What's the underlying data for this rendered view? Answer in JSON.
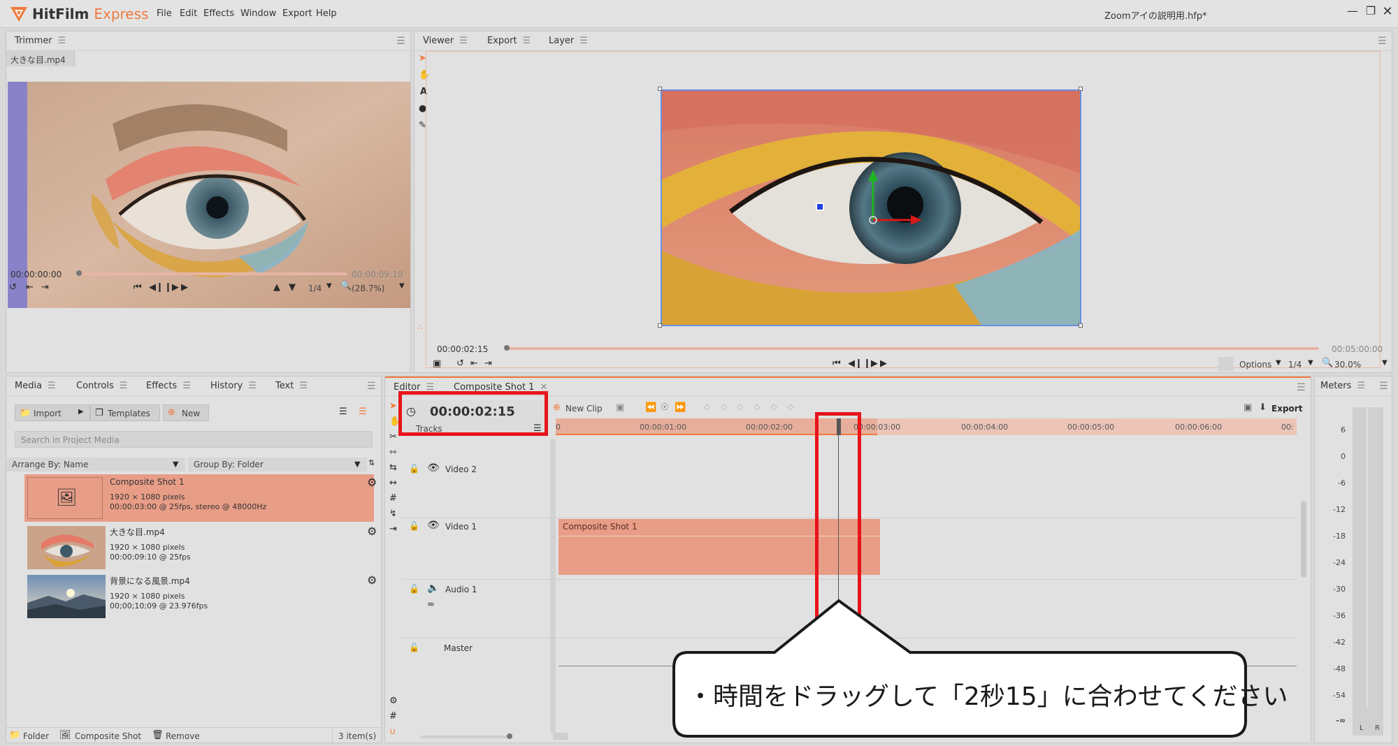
{
  "app": {
    "name_main": "HitFilm",
    "name_accent": "Express",
    "project_title": "Zoomアイの説明用.hfp*",
    "menu": [
      "File",
      "Edit",
      "Effects",
      "Window",
      "Export",
      "Help"
    ]
  },
  "trimmer": {
    "tab": "Trimmer",
    "file_tab": "大きな目.mp4",
    "time_current": "00:00:00:00",
    "time_total": "00:00:09:10",
    "quality": "1/4",
    "zoom": "(28.7%)"
  },
  "viewer": {
    "tabs": [
      "Viewer",
      "Export",
      "Layer"
    ],
    "time_current": "00:00:02:15",
    "time_total": "00:05:00:00",
    "options_label": "Options",
    "quality": "1/4",
    "zoom": "30.0%"
  },
  "media": {
    "tabs": [
      "Media",
      "Controls",
      "Effects",
      "History",
      "Text"
    ],
    "import_label": "Import",
    "templates_label": "Templates",
    "new_label": "New",
    "search_placeholder": "Search in Project Media",
    "arrange_label": "Arrange By: Name",
    "group_label": "Group By: Folder",
    "items": [
      {
        "name": "Composite Shot 1",
        "res": "1920 × 1080 pixels",
        "info": "00:00:03:00 @ 25fps, stereo @ 48000Hz",
        "selected": true
      },
      {
        "name": "大きな目.mp4",
        "res": "1920 × 1080 pixels",
        "info": "00:00:09:10 @ 25fps",
        "selected": false
      },
      {
        "name": "背景になる風景.mp4",
        "res": "1920 × 1080 pixels",
        "info": "00;00;10;09 @ 23.976fps",
        "selected": false
      }
    ],
    "footer_folder": "Folder",
    "footer_composite": "Composite Shot",
    "footer_remove": "Remove",
    "footer_count": "3 item(s)"
  },
  "editor": {
    "tabs": [
      "Editor",
      "Composite Shot 1"
    ],
    "timecode": "00:00:02:15",
    "tracks_label": "Tracks",
    "new_clip_label": "New Clip",
    "export_label": "Export",
    "ruler": [
      "0",
      "00:00:01:00",
      "00:00:02:00",
      "00:00:03:00",
      "00:00:04:00",
      "00:00:05:00",
      "00:00:06:00",
      "00:"
    ],
    "tracks": [
      "Video 2",
      "Video 1",
      "Audio 1",
      "Master"
    ],
    "clip_name": "Composite Shot 1"
  },
  "meters": {
    "tab": "Meters",
    "scale": [
      "6",
      "0",
      "-6",
      "-12",
      "-18",
      "-24",
      "-30",
      "-36",
      "-42",
      "-48",
      "-54",
      "-∞"
    ],
    "channel_l": "L",
    "channel_r": "R"
  },
  "callout": {
    "text": "・時間をドラッグして「2秒15」に合わせてください"
  },
  "colors": {
    "accent": "#f07a3c",
    "selection": "#e89d87",
    "highlight_red": "#e8141b",
    "gizmo_green": "#1fb51f",
    "gizmo_red": "#d81a1a",
    "gizmo_blue": "#1f3fe0"
  }
}
